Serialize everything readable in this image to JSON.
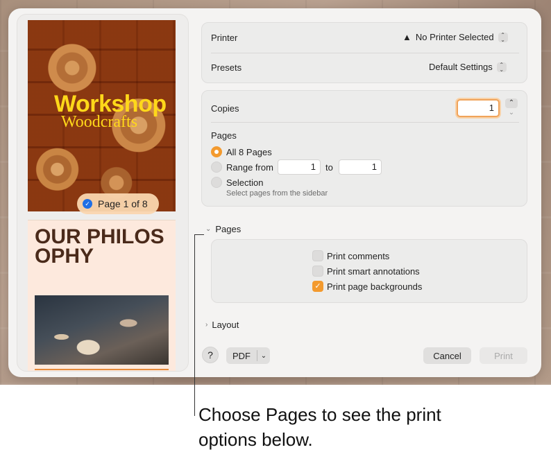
{
  "sidebar": {
    "page1": {
      "brand_title": "Workshop",
      "brand_subtitle": "Woodcrafts",
      "badge": "Page 1 of 8"
    },
    "page2": {
      "heading": "OUR PHILOSOPHY"
    }
  },
  "printer": {
    "label": "Printer",
    "value": "No Printer Selected",
    "warning_icon": "warning-triangle-icon"
  },
  "presets": {
    "label": "Presets",
    "value": "Default Settings"
  },
  "copies": {
    "label": "Copies",
    "value": "1"
  },
  "pages": {
    "label": "Pages",
    "options": [
      {
        "label": "All 8 Pages",
        "selected": true
      },
      {
        "label": "Range from",
        "selected": false
      },
      {
        "label": "Selection",
        "selected": false
      }
    ],
    "range_from": "1",
    "range_to_label": "to",
    "range_to": "1",
    "selection_hint": "Select pages from the sidebar"
  },
  "pages_section": {
    "title": "Pages",
    "checkboxes": [
      {
        "label": "Print comments",
        "checked": false
      },
      {
        "label": "Print smart annotations",
        "checked": false
      },
      {
        "label": "Print page backgrounds",
        "checked": true
      }
    ]
  },
  "layout_section": {
    "title": "Layout"
  },
  "footer": {
    "help": "?",
    "pdf": "PDF",
    "cancel": "Cancel",
    "print": "Print"
  },
  "callout": {
    "text": "Choose Pages to see the print options below."
  },
  "colors": {
    "accent": "#f39a2e",
    "brand_yellow": "#ffd81a",
    "check_blue": "#1f6fe5"
  }
}
